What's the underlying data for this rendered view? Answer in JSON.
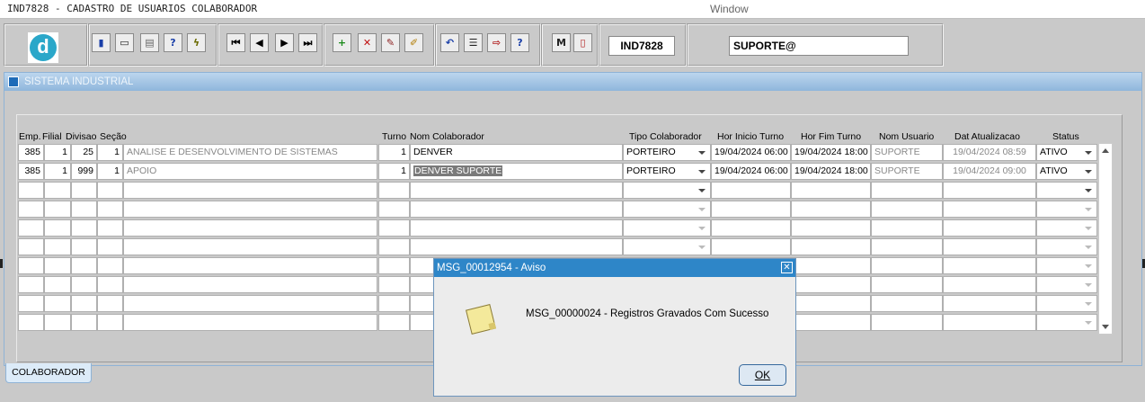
{
  "window": {
    "title": "IND7828 - CADASTRO DE USUARIOS COLABORADOR",
    "menu_label": "Window"
  },
  "toolbar": {
    "logo_letter": "d",
    "form_code": "IND7828",
    "user": "SUPORTE@",
    "buttons": [
      {
        "name": "save-button",
        "glyph": "▮",
        "color": "#1a3fa8"
      },
      {
        "name": "screen-button",
        "glyph": "▭",
        "color": "#222222"
      },
      {
        "name": "print-button",
        "glyph": "▤",
        "color": "#666666"
      },
      {
        "name": "query-help-button",
        "glyph": "?",
        "color": "#1a3fa8"
      },
      {
        "name": "execute-query-button",
        "glyph": "ϟ",
        "color": "#6b6b00"
      },
      {
        "name": "first-record-button",
        "glyph": "⏮",
        "color": "#000000"
      },
      {
        "name": "previous-record-button",
        "glyph": "◀",
        "color": "#000000"
      },
      {
        "name": "next-record-button",
        "glyph": "▶",
        "color": "#000000"
      },
      {
        "name": "last-record-button",
        "glyph": "⏭",
        "color": "#000000"
      },
      {
        "name": "insert-record-button",
        "glyph": "+",
        "color": "#1a8a1a"
      },
      {
        "name": "delete-record-button",
        "glyph": "✕",
        "color": "#c01010"
      },
      {
        "name": "clear-record-button",
        "glyph": "✎",
        "color": "#8a1a1a"
      },
      {
        "name": "edit-button",
        "glyph": "✐",
        "color": "#b07a00"
      },
      {
        "name": "undo-button",
        "glyph": "↶",
        "color": "#1a3fa8"
      },
      {
        "name": "list-button",
        "glyph": "☰",
        "color": "#222222"
      },
      {
        "name": "export-button",
        "glyph": "⇨",
        "color": "#b01a1a"
      },
      {
        "name": "help-button",
        "glyph": "?",
        "color": "#1a3fa8"
      },
      {
        "name": "menu-button",
        "glyph": "M",
        "color": "#222222"
      },
      {
        "name": "exit-button",
        "glyph": "▯",
        "color": "#b01a1a"
      }
    ]
  },
  "panel": {
    "title": "SISTEMA INDUSTRIAL",
    "tab_label": "COLABORADOR"
  },
  "grid": {
    "headers": {
      "emp": "Emp.",
      "filial": "Filial",
      "divisao": "Divisao",
      "secao": "Seção",
      "turno": "Turno",
      "nome": "Nom Colaborador",
      "tipo": "Tipo Colaborador",
      "inicio": "Hor Inicio Turno",
      "fim": "Hor Fim Turno",
      "usuario": "Nom Usuario",
      "atualizacao": "Dat Atualizacao",
      "status": "Status"
    },
    "rows": [
      {
        "emp": "385",
        "filial": "1",
        "divisao": "25",
        "secao": "1",
        "desc": "ANALISE E DESENVOLVIMENTO DE SISTEMAS",
        "turno": "1",
        "nome": "DENVER",
        "tipo": "PORTEIRO",
        "inicio": "19/04/2024 06:00",
        "fim": "19/04/2024 18:00",
        "usuario": "SUPORTE",
        "atualizacao": "19/04/2024 08:59",
        "status": "ATIVO"
      },
      {
        "emp": "385",
        "filial": "1",
        "divisao": "999",
        "secao": "1",
        "desc": "APOIO",
        "turno": "1",
        "nome": "DENVER SUPORTE",
        "tipo": "PORTEIRO",
        "inicio": "19/04/2024 06:00",
        "fim": "19/04/2024 18:00",
        "usuario": "SUPORTE",
        "atualizacao": "19/04/2024 09:00",
        "status": "ATIVO"
      }
    ]
  },
  "dialog": {
    "title": "MSG_00012954 - Aviso",
    "close_glyph": "✕",
    "message": "MSG_00000024 - Registros Gravados Com Sucesso",
    "ok_label": "OK"
  }
}
